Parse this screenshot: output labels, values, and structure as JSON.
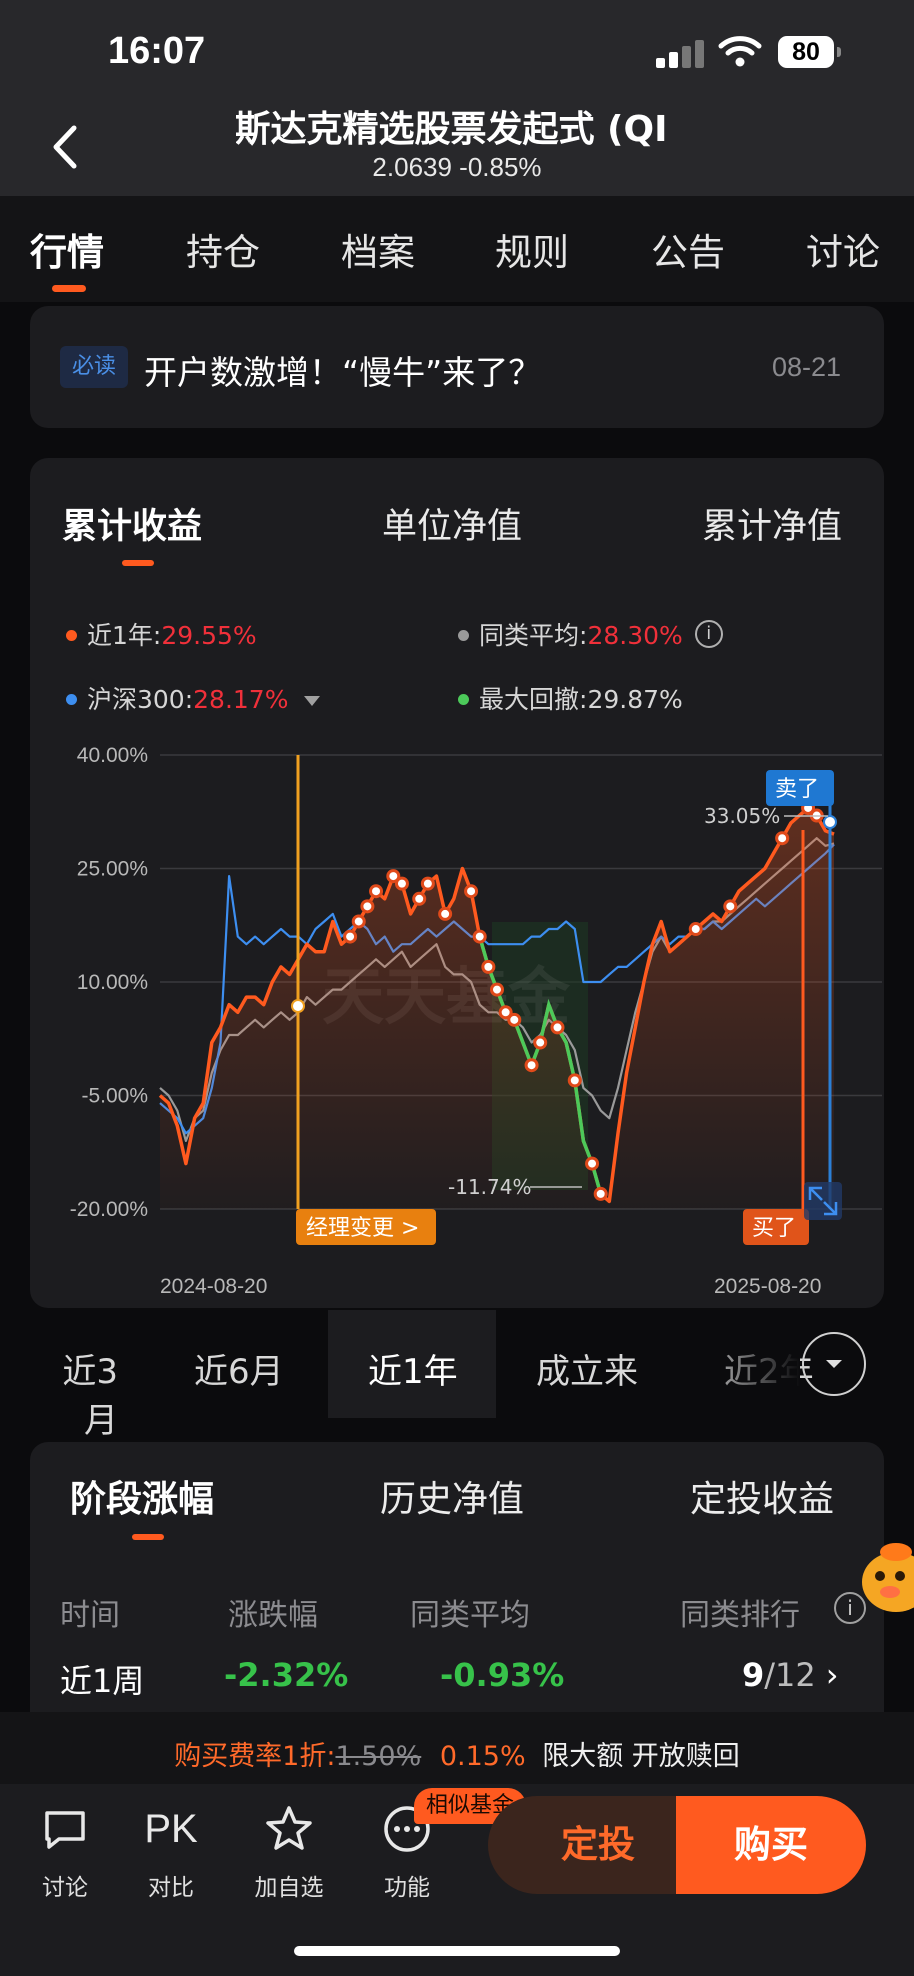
{
  "status_bar": {
    "time": "16:07",
    "battery": "80"
  },
  "header": {
    "title": "斯达克精选股票发起式 (QI",
    "price_change": "2.0639 -0.85%"
  },
  "tabs": [
    {
      "label": "行情",
      "active": true
    },
    {
      "label": "持仓"
    },
    {
      "label": "档案"
    },
    {
      "label": "规则"
    },
    {
      "label": "公告"
    },
    {
      "label": "讨论"
    }
  ],
  "notice": {
    "badge": "必读",
    "text": "开户数激增！“慢牛”来了？",
    "date": "08-21"
  },
  "chart_tabs": [
    {
      "label": "累计收益",
      "active": true
    },
    {
      "label": "单位净值"
    },
    {
      "label": "累计净值"
    }
  ],
  "legend": {
    "fund": {
      "label": "近1年:",
      "value": "29.55%",
      "color": "#ff5a1f"
    },
    "peer": {
      "label": "同类平均:",
      "value": "28.30%",
      "color": "#9a9a9a"
    },
    "index": {
      "label": "沪深300:",
      "value": "28.17%",
      "color": "#3d8ef0"
    },
    "drawdown": {
      "label": "最大回撤:",
      "value": "29.87%",
      "color": "#4cc95a"
    }
  },
  "chart_data": {
    "type": "line",
    "y_ticks": [
      "40.00%",
      "25.00%",
      "10.00%",
      "-5.00%",
      "-20.00%"
    ],
    "ylim": [
      -20,
      40
    ],
    "x_start": "2024-08-20",
    "x_end": "2025-08-20",
    "annotations": {
      "peak": "33.05%",
      "trough": "-11.74%",
      "manager_change": "经理变更 >",
      "sell": "卖了",
      "buy": "买了"
    },
    "series": [
      {
        "name": "近1年",
        "color": "#ff5a1f",
        "values": [
          -5,
          -6,
          -9,
          -14,
          -8,
          -6,
          2,
          4,
          7,
          6,
          8,
          8,
          7,
          10,
          12,
          11,
          13,
          15,
          14,
          14,
          18,
          15,
          16,
          18,
          20,
          22,
          21,
          24,
          23,
          19,
          21,
          23,
          24,
          19,
          21,
          25,
          22,
          16,
          12,
          9,
          6,
          5,
          2,
          -1,
          2,
          7,
          4,
          2,
          -3,
          -11,
          -14,
          -18,
          -19,
          -10,
          -2,
          4,
          10,
          15,
          18,
          14,
          15,
          16,
          17,
          18,
          19,
          18,
          20,
          22,
          23,
          24,
          25,
          27,
          29,
          31,
          32,
          33,
          32,
          30,
          29.55
        ]
      },
      {
        "name": "同类平均",
        "color": "#9a9a9a",
        "values": [
          -4,
          -5,
          -7,
          -11,
          -8,
          -7,
          -2,
          1,
          3,
          3,
          4,
          5,
          4,
          5,
          6,
          5,
          6,
          8,
          7,
          8,
          9,
          9,
          10,
          11,
          12,
          13,
          12,
          13,
          14,
          12,
          13,
          14,
          15,
          12,
          11,
          11,
          10,
          7,
          6,
          6,
          5,
          5,
          4,
          2,
          3,
          5,
          4,
          3,
          1,
          -4,
          -5,
          -7,
          -8,
          -4,
          1,
          6,
          10,
          14,
          16,
          14,
          15,
          16,
          17,
          17,
          18,
          18,
          19,
          20,
          21,
          22,
          23,
          24,
          25,
          26,
          27,
          28,
          29,
          28,
          28.3
        ]
      },
      {
        "name": "沪深300",
        "color": "#3d8ef0",
        "values": [
          -6,
          -7,
          -8,
          -10,
          -9,
          -8,
          -4,
          2,
          24,
          16,
          15,
          16,
          15,
          16,
          17,
          16,
          16,
          15,
          17,
          18,
          19,
          16,
          17,
          18,
          17,
          15,
          16,
          14,
          15,
          15,
          16,
          17,
          16,
          17,
          18,
          17,
          16,
          16,
          15,
          15,
          15,
          15,
          15,
          16,
          16,
          17,
          17,
          18,
          17,
          10,
          10,
          10,
          11,
          12,
          12,
          13,
          14,
          15,
          16,
          15,
          16,
          16,
          17,
          17,
          18,
          17,
          18,
          19,
          20,
          21,
          20,
          21,
          22,
          23,
          24,
          25,
          26,
          27,
          28.17
        ]
      }
    ]
  },
  "ranges": [
    {
      "label": "近3月"
    },
    {
      "label": "近6月"
    },
    {
      "label": "近1年",
      "active": true
    },
    {
      "label": "成立来"
    },
    {
      "label": "近2年"
    }
  ],
  "perf_tabs": [
    {
      "label": "阶段涨幅",
      "active": true
    },
    {
      "label": "历史净值"
    },
    {
      "label": "定投收益"
    }
  ],
  "perf_table": {
    "headers": [
      "时间",
      "涨跌幅",
      "同类平均",
      "同类排行"
    ],
    "rows": [
      {
        "period": "近1周",
        "change": "-2.32%",
        "peer_avg": "-0.93%",
        "rank": "9",
        "rank_total": "/12"
      }
    ]
  },
  "promo": {
    "prefix": "购买费率1折:",
    "old_rate": "1.50%",
    "new_rate": "0.15%",
    "suffix": "限大额 开放赎回"
  },
  "bottom_bar": {
    "items": [
      {
        "label": "讨论",
        "icon": "chat-icon"
      },
      {
        "label": "对比",
        "icon_text": "PK"
      },
      {
        "label": "加自选",
        "icon": "star-icon"
      },
      {
        "label": "功能",
        "icon": "more-icon"
      }
    ],
    "similar_badge": "相似基金",
    "dingtou_label": "定投",
    "buy_label": "购买"
  }
}
